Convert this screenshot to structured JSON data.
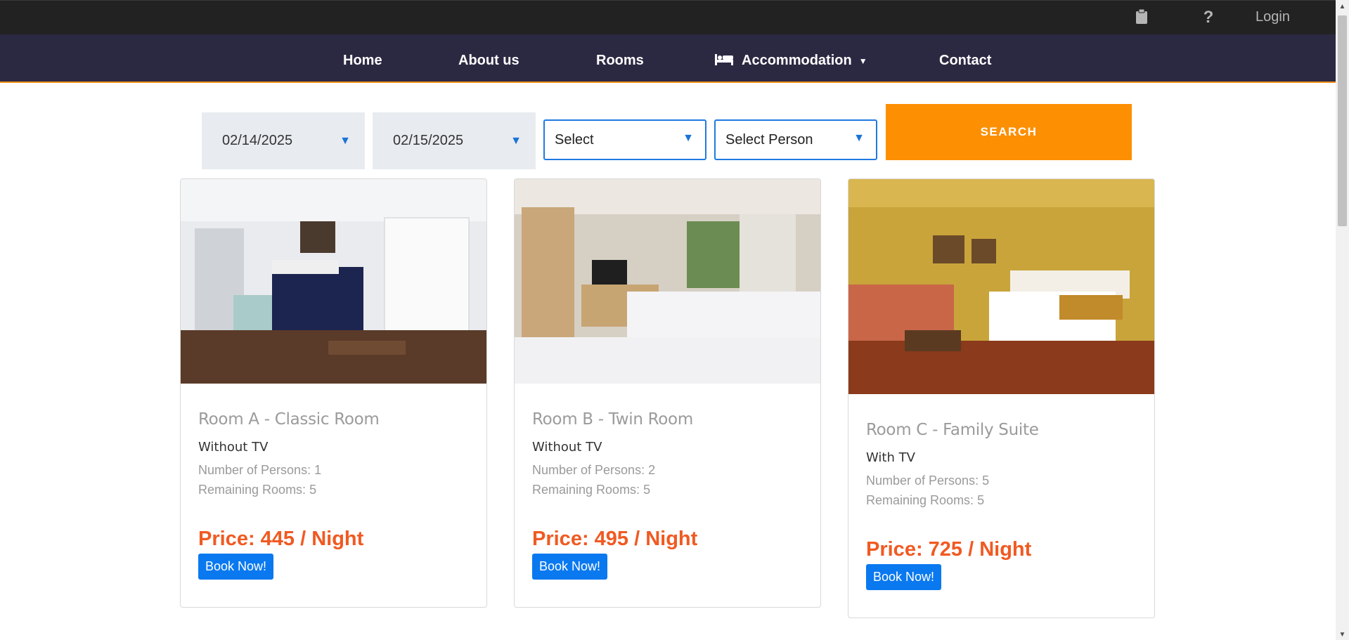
{
  "topbar": {
    "login_label": "Login",
    "icons": [
      "clipboard-icon",
      "question-icon"
    ]
  },
  "nav": {
    "home": "Home",
    "about": "About us",
    "rooms": "Rooms",
    "accommodation": "Accommodation",
    "contact": "Contact"
  },
  "search": {
    "checkin": "02/14/2025",
    "checkout": "02/15/2025",
    "room_select": "Select",
    "person_select": "Select Person",
    "button": "SEARCH"
  },
  "rooms": [
    {
      "title": "Room A - Classic Room",
      "tv": "Without TV",
      "persons": "Number of Persons: 1",
      "remaining": "Remaining Rooms: 5",
      "price": "Price: 445 / Night",
      "book": "Book Now!"
    },
    {
      "title": "Room B - Twin Room",
      "tv": "Without TV",
      "persons": "Number of Persons: 2",
      "remaining": "Remaining Rooms: 5",
      "price": "Price: 495 / Night",
      "book": "Book Now!"
    },
    {
      "title": "Room C - Family Suite",
      "tv": "With TV",
      "persons": "Number of Persons: 5",
      "remaining": "Remaining Rooms: 5",
      "price": "Price: 725 / Night",
      "book": "Book Now!"
    }
  ],
  "colors": {
    "nav_bg": "#2b2942",
    "accent": "#fd8f03",
    "price": "#f05a22",
    "button": "#0a79f0"
  }
}
